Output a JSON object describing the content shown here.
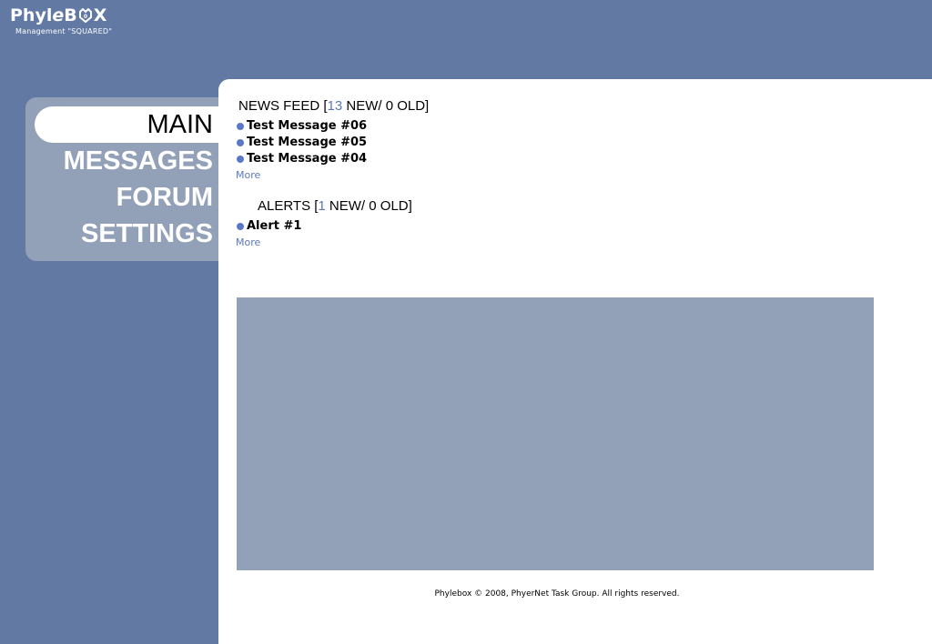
{
  "logo": {
    "title_left": "Phyl",
    "title_e": "e",
    "title_b": "B",
    "title_x": "X",
    "tagline": "Management \"SQUARED\""
  },
  "nav": {
    "items": [
      {
        "label": "MAIN",
        "active": true
      },
      {
        "label": "MESSAGES",
        "active": false
      },
      {
        "label": "FORUM",
        "active": false
      },
      {
        "label": "SETTINGS",
        "active": false
      }
    ]
  },
  "news_feed": {
    "title_prefix": "NEWS FEED [",
    "new_count": "13",
    "title_suffix": " NEW/ 0 OLD]",
    "items": [
      "Test Message #06",
      "Test Message #05",
      "Test Message #04"
    ],
    "more_label": "More"
  },
  "alerts": {
    "title_prefix": "ALERTS [",
    "new_count": "1",
    "title_suffix": " NEW/ 0 OLD]",
    "items": [
      "Alert #1"
    ],
    "more_label": "More"
  },
  "footer": {
    "text": "Phylebox © 2008, PhyerNet Task Group. All rights reserved."
  },
  "colors": {
    "background": "#6279a4",
    "nav_panel": "#93a1b8",
    "accent": "#5b78b8",
    "content_box": "#92a1b8"
  }
}
